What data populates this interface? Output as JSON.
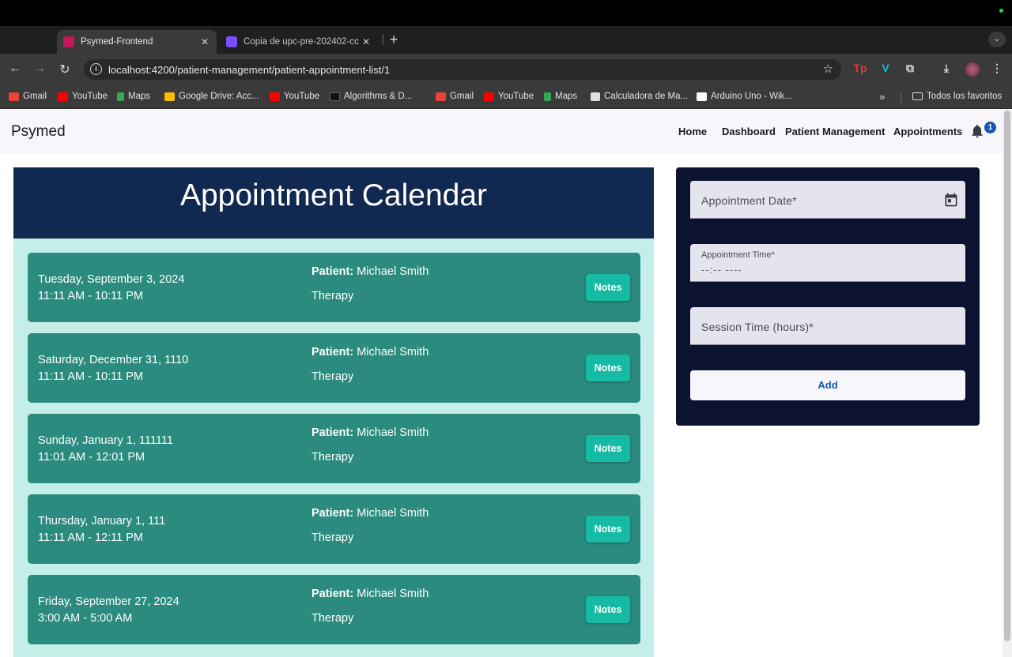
{
  "browser": {
    "tabs": [
      {
        "title": "Psymed-Frontend",
        "active": true,
        "favicon_color": "#c2185b"
      },
      {
        "title": "Copia de upc-pre-202402-cc",
        "active": false,
        "favicon_color": "#7c4dff"
      }
    ],
    "url": "localhost:4200/patient-management/patient-appointment-list/1",
    "bookmarks": [
      {
        "label": "Gmail",
        "icon": "gmail-icon",
        "color": "#ea4335"
      },
      {
        "label": "YouTube",
        "icon": "youtube-icon",
        "color": "#ff0000"
      },
      {
        "label": "Maps",
        "icon": "maps-icon",
        "color": "#34a853"
      },
      {
        "label": "Google Drive: Acc...",
        "icon": "drive-icon",
        "color": "#fbbc04"
      },
      {
        "label": "YouTube",
        "icon": "youtube-icon",
        "color": "#ff0000"
      },
      {
        "label": "Algorithms & D...",
        "icon": "algorithms-icon",
        "color": "#222222"
      },
      {
        "label": "Gmail",
        "icon": "gmail-icon",
        "color": "#ea4335"
      },
      {
        "label": "YouTube",
        "icon": "youtube-icon",
        "color": "#ff0000"
      },
      {
        "label": "Maps",
        "icon": "maps-icon",
        "color": "#34a853"
      },
      {
        "label": "Calculadora de Ma...",
        "icon": "calculator-icon",
        "color": "#e0e0e0"
      },
      {
        "label": "Arduino Uno - Wik...",
        "icon": "wikipedia-icon",
        "color": "#ffffff"
      }
    ],
    "all_bookmarks_label": "Todos los favoritos"
  },
  "app": {
    "brand": "Psymed",
    "nav": [
      "Home",
      "Dashboard",
      "Patient Management",
      "Appointments"
    ],
    "notification_count": "1"
  },
  "calendar": {
    "title": "Appointment Calendar",
    "patient_label": "Patient:",
    "notes_label": "Notes",
    "appointments": [
      {
        "date": "Tuesday, September 3, 2024",
        "time": "11:11 AM - 10:11 PM",
        "patient": "Michael Smith",
        "type": "Therapy"
      },
      {
        "date": "Saturday, December 31, 1110",
        "time": "11:11 AM - 10:11 PM",
        "patient": "Michael Smith",
        "type": "Therapy"
      },
      {
        "date": "Sunday, January 1, 111111",
        "time": "11:01 AM - 12:01 PM",
        "patient": "Michael Smith",
        "type": "Therapy"
      },
      {
        "date": "Thursday, January 1, 111",
        "time": "11:11 AM - 12:11 PM",
        "patient": "Michael Smith",
        "type": "Therapy"
      },
      {
        "date": "Friday, September 27, 2024",
        "time": "3:00 AM - 5:00 AM",
        "patient": "Michael Smith",
        "type": "Therapy"
      }
    ]
  },
  "form": {
    "date_label": "Appointment Date*",
    "time_label": "Appointment Time*",
    "time_value": "--:-- ----",
    "session_label": "Session Time (hours)*",
    "add_label": "Add"
  },
  "colors": {
    "header_bg": "#112850",
    "card_bg": "#2b8b7e",
    "notes_bg": "#16bba5",
    "panel_bg": "#c4eee9",
    "form_bg": "#0c1331",
    "accent": "#1557b0"
  }
}
